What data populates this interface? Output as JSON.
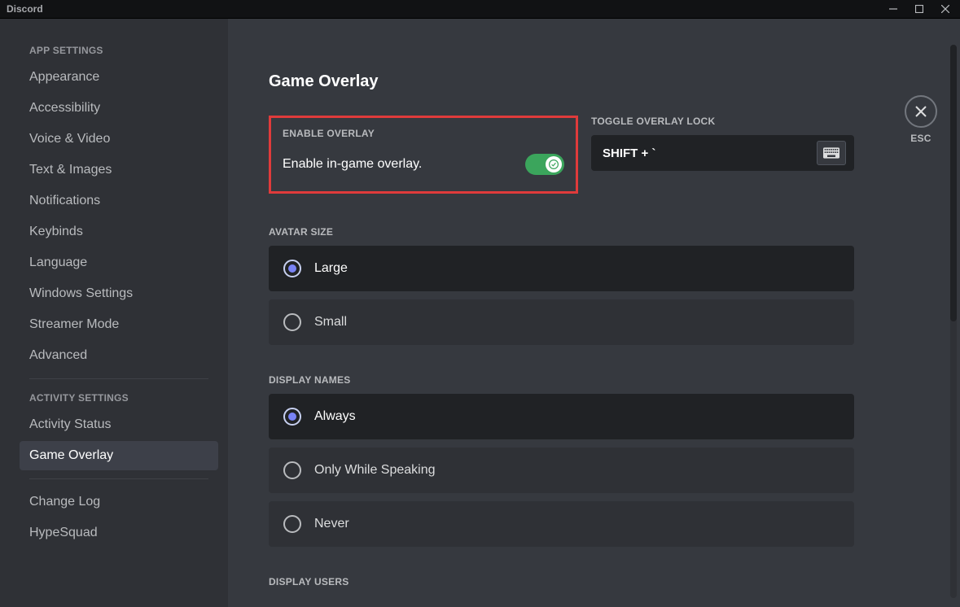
{
  "app": {
    "name": "Discord"
  },
  "close": {
    "esc": "ESC"
  },
  "sidebar": {
    "sections": [
      {
        "header": "APP SETTINGS",
        "items": [
          {
            "label": "Appearance",
            "selected": false
          },
          {
            "label": "Accessibility",
            "selected": false
          },
          {
            "label": "Voice & Video",
            "selected": false
          },
          {
            "label": "Text & Images",
            "selected": false
          },
          {
            "label": "Notifications",
            "selected": false
          },
          {
            "label": "Keybinds",
            "selected": false
          },
          {
            "label": "Language",
            "selected": false
          },
          {
            "label": "Windows Settings",
            "selected": false
          },
          {
            "label": "Streamer Mode",
            "selected": false
          },
          {
            "label": "Advanced",
            "selected": false
          }
        ]
      },
      {
        "header": "ACTIVITY SETTINGS",
        "items": [
          {
            "label": "Activity Status",
            "selected": false
          },
          {
            "label": "Game Overlay",
            "selected": true
          }
        ]
      },
      {
        "header": "",
        "items": [
          {
            "label": "Change Log",
            "selected": false
          },
          {
            "label": "HypeSquad",
            "selected": false
          }
        ]
      }
    ]
  },
  "page": {
    "title": "Game Overlay",
    "enable": {
      "header": "ENABLE OVERLAY",
      "label": "Enable in-game overlay.",
      "on": true
    },
    "lock": {
      "header": "TOGGLE OVERLAY LOCK",
      "keybind": "SHIFT + `"
    },
    "avatar": {
      "header": "AVATAR SIZE",
      "options": [
        {
          "label": "Large",
          "selected": true
        },
        {
          "label": "Small",
          "selected": false
        }
      ]
    },
    "displayNames": {
      "header": "DISPLAY NAMES",
      "options": [
        {
          "label": "Always",
          "selected": true
        },
        {
          "label": "Only While Speaking",
          "selected": false
        },
        {
          "label": "Never",
          "selected": false
        }
      ]
    },
    "displayUsers": {
      "header": "DISPLAY USERS"
    }
  },
  "colors": {
    "highlight": "#e03b3b",
    "toggleOn": "#3ba55c"
  }
}
